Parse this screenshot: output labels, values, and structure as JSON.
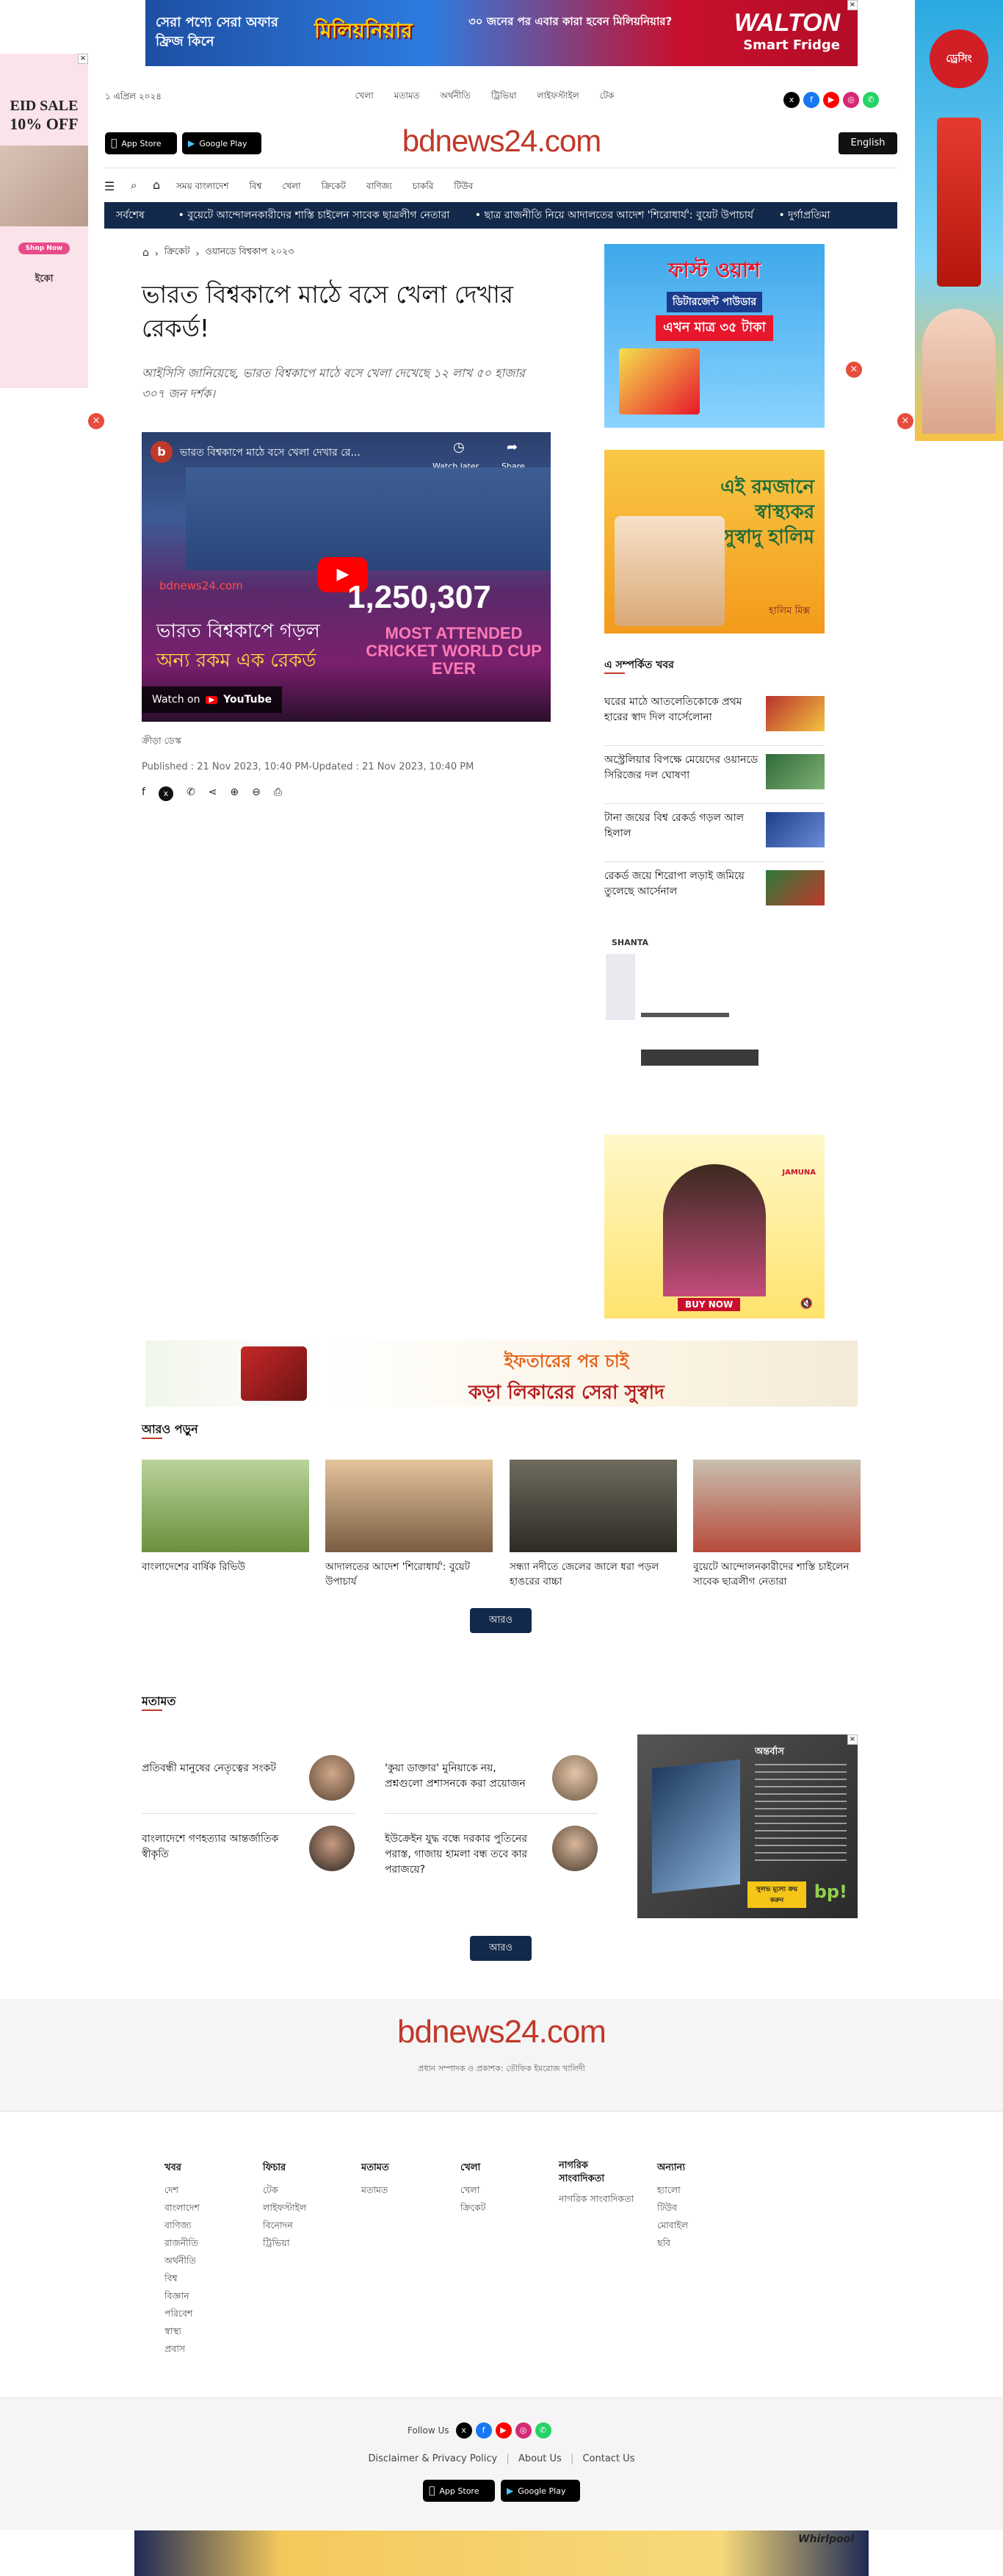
{
  "colors": {
    "brand": "#c0392b",
    "navy": "#13294b",
    "walton": "#c8102e"
  },
  "ads": {
    "top_banner": {
      "text1": "সেরা পণ্যে সেরা অফার",
      "text2": "ফ্রিজ কিনে",
      "badge": "মিলিয়নিয়ার",
      "middle": "৩০ জনের পর এবার কারা হবেন মিলিয়নিয়ার?",
      "brand": "WALTON",
      "brand_sub": "Smart Fridge"
    },
    "left_side": {
      "line1": "EID SALE",
      "line2": "10% OFF",
      "shop": "Shop Now",
      "logo": "ইকো"
    },
    "right_side": {
      "brand": "ড্রেসিং"
    },
    "side1": {
      "title": "ফাস্ট ওয়াশ",
      "sub": "ডিটারজেন্ট পাউডার",
      "price": "এখন মাত্র ৩৫ টাকা"
    },
    "side2": {
      "line1": "এই রমজানে",
      "line2": "স্বাস্থ্যকর",
      "line3": "সুস্বাদু হালিম",
      "sub": "হালিম মিক্স"
    },
    "shanta": {
      "logo": "SHANTA"
    },
    "jamuna": {
      "logo": "JAMUNA",
      "cta": "BUY NOW"
    },
    "mid_banner": {
      "text1": "ইফতারের পর চাই",
      "text2": "কড়া লিকারের সেরা সুস্বাদ"
    },
    "book_ad": {
      "title": "অন্তর্বাস",
      "btn": "সুলভ মূল্যে ক্রয় করুন",
      "logo": "bp!"
    },
    "bottom_banner": {
      "brand": "Whirlpool"
    }
  },
  "header": {
    "date": "১ এপ্রিল ২০২৪",
    "top_nav": [
      "খেলা",
      "মতামত",
      "অর্থনীতি",
      "ট্রিভিয়া",
      "লাইফস্টাইল",
      "টেক"
    ],
    "social": [
      "x",
      "f",
      "▶",
      "◎",
      "✆"
    ],
    "app_store": "App Store",
    "google_play": "Google Play",
    "logo": "bdnews24.com",
    "english": "English"
  },
  "main_nav": [
    "সময় বাংলাদেশ",
    "বিশ্ব",
    "খেলা",
    "ক্রিকেট",
    "বাণিজ্য",
    "চাকরি",
    "টিউব"
  ],
  "ticker": {
    "label": "সর্বশেষ",
    "items": [
      "বুয়েটে আন্দোলনকারীদের শাস্তি চাইলেন সাবেক ছাত্রলীগ নেতারা",
      "ছাত্র রাজনীতি নিয়ে আদালতের আদেশ 'শিরোধার্য': বুয়েট উপাচার্য",
      "দুর্গাপ্রতিমা"
    ]
  },
  "breadcrumb": [
    "ক্রিকেট",
    "ওয়ানডে বিশ্বকাপ ২০২৩"
  ],
  "article": {
    "title": "ভারত বিশ্বকাপে মাঠে বসে খেলা দেখার রেকর্ড!",
    "summary": "আইসিসি জানিয়েছে, ভারত বিশ্বকাপে মাঠে বসে খেলা দেখেছে ১২ লাখ ৫০ হাজার ৩০৭ জন দর্শক।",
    "video_title": "ভারত বিশ্বকাপে মাঠে বসে খেলা দেখার রে...",
    "watch_later": "Watch later",
    "share": "Share",
    "video_source": "bdnews24.com",
    "video_number": "1,250,307",
    "video_sub": "MOST ATTENDED CRICKET WORLD CUP EVER",
    "video_caption1": "ভারত বিশ্বকাপে গড়ল",
    "video_caption2": "অন্য রকম এক রেকর্ড",
    "watch_on": "Watch on",
    "youtube": "YouTube",
    "author": "ক্রীড়া ডেস্ক",
    "published": "Published : 21 Nov 2023, 10:40 PM",
    "updated": "Updated : 21 Nov 2023, 10:40 PM"
  },
  "related": {
    "heading": "এ সম্পর্কিত খবর",
    "items": [
      {
        "title": "ঘরের মাঠে আতলেতিকোকে প্রথম হারের স্বাদ দিল বার্সেলোনা"
      },
      {
        "title": "অস্ট্রেলিয়ার বিপক্ষে মেয়েদের ওয়ানডে সিরিজের দল ঘোষণা"
      },
      {
        "title": "টানা জয়ের বিশ্ব রেকর্ড গড়ল আল হিলাল"
      },
      {
        "title": "রেকর্ড জয়ে শিরোপা লড়াই জমিয়ে তুলেছে আর্সেনাল"
      }
    ]
  },
  "more": {
    "heading": "আরও পড়ুন",
    "items": [
      {
        "title": "বাংলাদেশের বার্ষিক রিভিউ"
      },
      {
        "title": "আদালতের আদেশ 'শিরোধার্য': বুয়েট উপাচার্য"
      },
      {
        "title": "সন্ধ্যা নদীতে জেলের জালে ধরা পড়ল হাঙরের বাচ্চা"
      },
      {
        "title": "বুয়েটে আন্দোলনকারীদের শাস্তি চাইলেন সাবেক ছাত্রলীগ নেতারা"
      }
    ],
    "button": "আরও"
  },
  "opinion": {
    "heading": "মতামত",
    "items": [
      {
        "title": "প্রতিবন্ধী মানুষের নেতৃত্বের সংকট"
      },
      {
        "title": "'কুয়া ডাক্তার' মুনিয়াকে নয়, প্রশ্নগুলো প্রশাসনকে করা প্রয়োজন"
      },
      {
        "title": "বাংলাদেশে গণহত্যার আন্তর্জাতিক স্বীকৃতি"
      },
      {
        "title": "ইউক্রেইন যুদ্ধ বন্ধে দরকার পুতিনের পরাস্ত, গাজায় হামলা বন্ধ তবে কার পরাজয়ে?"
      }
    ],
    "button": "আরও"
  },
  "footer": {
    "logo": "bdnews24.com",
    "editor": "প্রধান সম্পাদক ও প্রকাশক: তৌফিক ইমরোজ খালিদী",
    "columns": [
      {
        "heading": "খবর",
        "links": [
          "দেশ",
          "বাংলাদেশ",
          "বাণিজ্য",
          "রাজনীতি",
          "অর্থনীতি",
          "বিশ্ব",
          "বিজ্ঞান",
          "পরিবেশ",
          "স্বাস্থ্য",
          "প্রবাস"
        ]
      },
      {
        "heading": "ফিচার",
        "links": [
          "টেক",
          "লাইফস্টাইল",
          "বিনোদন",
          "ট্রিভিয়া"
        ]
      },
      {
        "heading": "মতামত",
        "links": [
          "মতামত"
        ]
      },
      {
        "heading": "খেলা",
        "links": [
          "খেলা",
          "ক্রিকেট"
        ]
      },
      {
        "heading": "নাগরিক সাংবাদিকতা",
        "links": [
          "নাগরিক সাংবাদিকতা"
        ]
      },
      {
        "heading": "অন্যান্য",
        "links": [
          "হ্যালো",
          "টিউব",
          "মোবাইল",
          "ছবি"
        ]
      }
    ],
    "follow": "Follow Us",
    "links": [
      "Disclaimer & Privacy Policy",
      "About Us",
      "Contact Us"
    ],
    "app_store": "App Store",
    "google_play": "Google Play"
  }
}
